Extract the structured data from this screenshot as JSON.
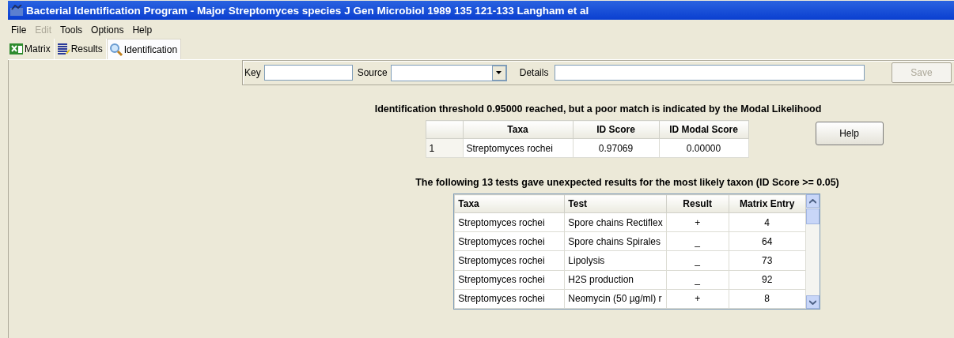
{
  "window": {
    "title": "Bacterial Identification Program - Major Streptomyces species J Gen Microbiol 1989 135 121-133 Langham et al"
  },
  "menu": [
    {
      "label": "File",
      "disabled": false
    },
    {
      "label": "Edit",
      "disabled": true
    },
    {
      "label": "Tools",
      "disabled": false
    },
    {
      "label": "Options",
      "disabled": false
    },
    {
      "label": "Help",
      "disabled": false
    }
  ],
  "tabs": [
    {
      "label": "Matrix",
      "kind": "matrix",
      "selected": false
    },
    {
      "label": "Results",
      "kind": "results",
      "selected": false
    },
    {
      "label": "Identification",
      "kind": "search",
      "selected": true
    }
  ],
  "toolbar": {
    "key_label": "Key",
    "source_label": "Source",
    "details_label": "Details",
    "save_button": {
      "label": "Save",
      "disabled": true
    }
  },
  "message": "Identification threshold 0.95000 reached, but a poor match is indicated by the Modal Likelihood",
  "id_table": {
    "columns": [
      "",
      "Taxa",
      "ID Score",
      "ID Modal Score"
    ],
    "rows": [
      [
        "1",
        "Streptomyces rochei",
        "0.97069",
        "0.00000"
      ]
    ]
  },
  "help_button": "Help",
  "unexpected_message": "The following 13 tests gave unexpected results for the most likely taxon (ID Score >= 0.05)",
  "tests_table": {
    "columns": [
      "Taxa",
      "Test",
      "Result",
      "Matrix Entry"
    ],
    "rows": [
      [
        "Streptomyces rochei",
        "Spore chains Rectiflex",
        "+",
        "4"
      ],
      [
        "Streptomyces rochei",
        "Spore chains Spirales",
        "_",
        "64"
      ],
      [
        "Streptomyces rochei",
        "Lipolysis",
        "_",
        "73"
      ],
      [
        "Streptomyces rochei",
        "H2S production",
        "_",
        "92"
      ],
      [
        "Streptomyces rochei",
        "Neomycin (50 µg/ml) r",
        "+",
        "8"
      ]
    ]
  }
}
